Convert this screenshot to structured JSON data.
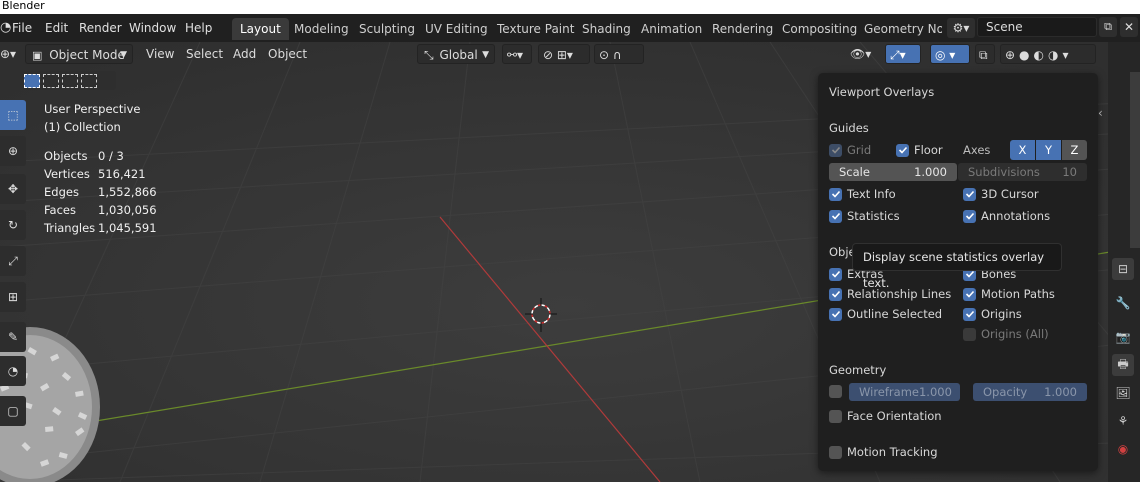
{
  "app": {
    "title": "Blender"
  },
  "menus": [
    "File",
    "Edit",
    "Render",
    "Window",
    "Help"
  ],
  "workspaces": [
    "Layout",
    "Modeling",
    "Sculpting",
    "UV Editing",
    "Texture Paint",
    "Shading",
    "Animation",
    "Rendering",
    "Compositing",
    "Geometry Nod"
  ],
  "active_workspace": "Layout",
  "scene": {
    "name": "Scene"
  },
  "viewport_header": {
    "mode": "Object Mode",
    "menus": [
      "View",
      "Select",
      "Add",
      "Object"
    ],
    "transform_orientation": "Global"
  },
  "viewport_info": {
    "perspective": "User Perspective",
    "collection": "(1) Collection",
    "stats": [
      {
        "label": "Objects",
        "value": "0 / 3"
      },
      {
        "label": "Vertices",
        "value": "516,421"
      },
      {
        "label": "Edges",
        "value": "1,552,866"
      },
      {
        "label": "Faces",
        "value": "1,030,056"
      },
      {
        "label": "Triangles",
        "value": "1,045,591"
      }
    ]
  },
  "overlays": {
    "title": "Viewport Overlays",
    "guides": {
      "heading": "Guides",
      "grid": "Grid",
      "floor": "Floor",
      "axes": "Axes",
      "axis_x": "X",
      "axis_y": "Y",
      "axis_z": "Z",
      "scale_label": "Scale",
      "scale_value": "1.000",
      "subdiv_label": "Subdivisions",
      "subdiv_value": "10",
      "text_info": "Text Info",
      "cursor_3d": "3D Cursor",
      "statistics": "Statistics",
      "annotations": "Annotations"
    },
    "objects": {
      "heading": "Obje",
      "extras": "Extras",
      "bones": "Bones",
      "relationship_lines": "Relationship Lines",
      "motion_paths": "Motion Paths",
      "outline_selected": "Outline Selected",
      "origins": "Origins",
      "origins_all": "Origins (All)"
    },
    "geometry": {
      "heading": "Geometry",
      "wireframe_label": "Wireframe",
      "wireframe_value": "1.000",
      "opacity_label": "Opacity",
      "opacity_value": "1.000",
      "face_orientation": "Face Orientation",
      "motion_tracking": "Motion Tracking"
    },
    "tooltip": "Display scene statistics overlay text."
  },
  "colors": {
    "accent": "#4772b3",
    "panel_bg": "#1f1f1f",
    "viewport_bg": "#393939",
    "x_axis": "#b03a3a",
    "y_axis": "#6a8a2a"
  }
}
